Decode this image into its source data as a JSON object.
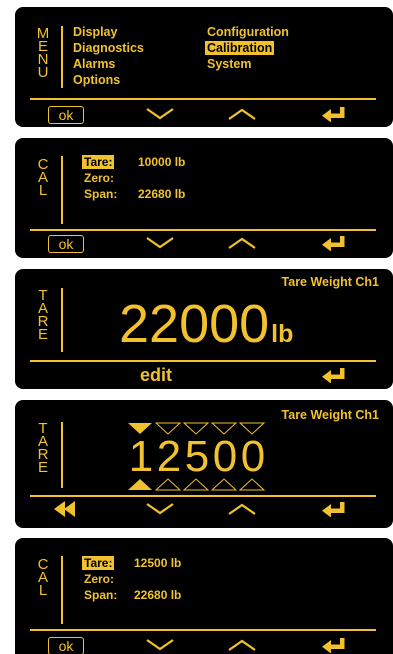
{
  "colors": {
    "accent": "#f2c12e",
    "background": "#000000"
  },
  "screen1": {
    "side_label": [
      "M",
      "E",
      "N",
      "U"
    ],
    "left_items": [
      "Display",
      "Diagnostics",
      "Alarms",
      "Options"
    ],
    "right_items": [
      "Configuration",
      "Calibration",
      "System"
    ],
    "selected": "Calibration",
    "ok_label": "ok",
    "nav_icons": [
      "chevron-down-icon",
      "chevron-up-icon",
      "enter-icon"
    ]
  },
  "screen2": {
    "side_label": [
      "C",
      "A",
      "L"
    ],
    "rows": [
      {
        "label": "Tare:",
        "value": "10000 lb"
      },
      {
        "label": "Zero:",
        "value": ""
      },
      {
        "label": "Span:",
        "value": "22680 lb"
      }
    ],
    "ok_label": "ok"
  },
  "screen3": {
    "side_label": [
      "T",
      "A",
      "R",
      "E"
    ],
    "title": "Tare Weight Ch1",
    "value": "22000",
    "unit": "lb",
    "action_label": "edit"
  },
  "screen4": {
    "side_label": [
      "T",
      "A",
      "R",
      "E"
    ],
    "title": "Tare Weight Ch1",
    "digits": [
      "1",
      "2",
      "5",
      "0",
      "0"
    ],
    "active_digit": 1
  },
  "screen5": {
    "side_label": [
      "C",
      "A",
      "L"
    ],
    "rows": [
      {
        "label": "Tare:",
        "value": "12500 lb"
      },
      {
        "label": "Zero:",
        "value": ""
      },
      {
        "label": "Span:",
        "value": "22680 lb"
      }
    ],
    "ok_label": "ok"
  }
}
